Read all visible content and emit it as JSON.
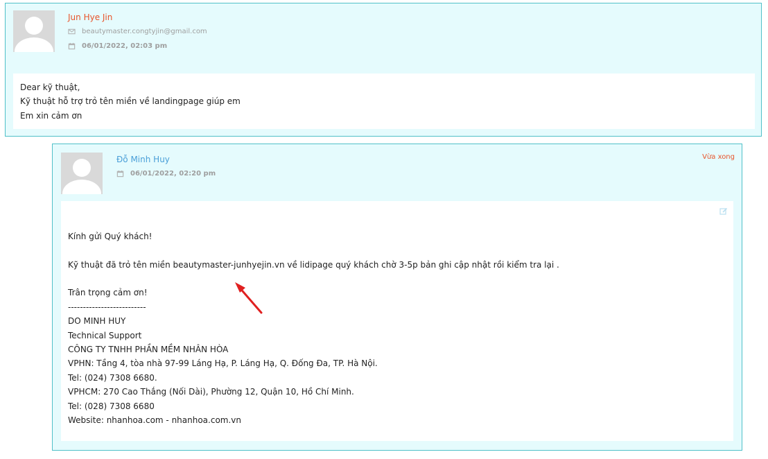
{
  "colors": {
    "card_bg": "#e5fbfd",
    "card_border": "#4fc0c8",
    "customer_name": "#e8542b",
    "staff_name": "#4a9fd8",
    "status": "#e8542b",
    "annotation_arrow": "#e02020"
  },
  "customer_message": {
    "name": "Jun Hye Jin",
    "email": "beautymaster.congtyjin@gmail.com",
    "email_icon": "envelope-icon",
    "date": "06/01/2022, 02:03 pm",
    "date_icon": "calendar-icon",
    "lines": [
      "Dear kỹ thuật,",
      "Kỹ thuật hỗ trợ trỏ tên miền về landingpage giúp em",
      "Em xin cảm ơn"
    ]
  },
  "staff_reply": {
    "name": "Đỗ Minh Huy",
    "date": "06/01/2022, 02:20 pm",
    "date_icon": "calendar-icon",
    "status": "Vừa xong",
    "edit_icon": "edit-icon",
    "lines": [
      "",
      "",
      "Kính gửi Quý khách!",
      "",
      "Kỹ thuật đã trỏ tên miền beautymaster-junhyejin.vn về lidipage quý khách chờ 3-5p bản ghi cập nhật rồi kiểm tra lại .",
      "",
      "Trân trọng cảm ơn!",
      "--------------------------",
      "DO MINH HUY",
      "Technical Support",
      "CÔNG TY TNHH PHẦN MỀM NHÂN HÒA",
      "VPHN: Tầng 4, tòa nhà 97-99 Láng Hạ, P. Láng Hạ, Q. Đống Đa, TP. Hà Nội.",
      "Tel: (024) 7308 6680.",
      "VPHCM: 270 Cao Thắng (Nối Dài), Phường 12, Quận 10, Hồ Chí Minh.",
      "Tel: (028) 7308 6680",
      "Website: nhanhoa.com - nhanhoa.com.vn"
    ]
  },
  "annotation": {
    "icon": "red-arrow-icon"
  }
}
